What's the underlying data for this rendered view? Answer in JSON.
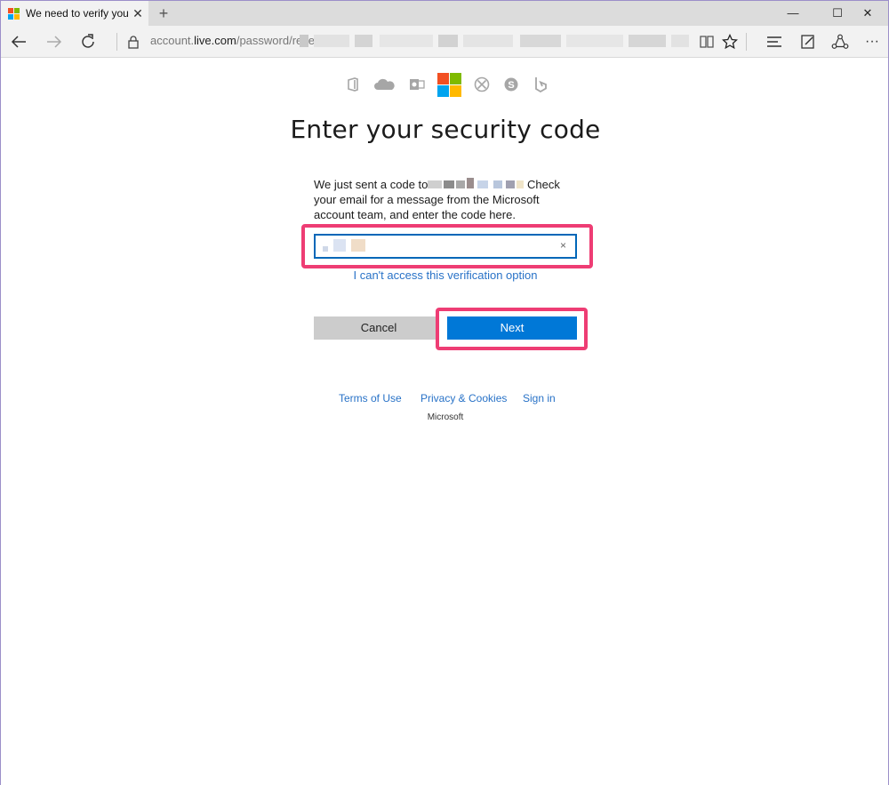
{
  "browser": {
    "tab_title": "We need to verify your i",
    "new_tab_symbol": "+",
    "tab_close_symbol": "✕",
    "url_prefix": "account.",
    "url_domain": "live.com",
    "url_path": "/password/reset",
    "window_controls": {
      "minimize": "—",
      "maximize": "☐",
      "close": "✕"
    },
    "more_symbol": "···"
  },
  "page": {
    "heading": "Enter your security code",
    "description_part1": "We just sent a code to",
    "description_part2": " Check your email for a message from the Microsoft account team, and enter the code here.",
    "clear_symbol": "×",
    "cant_access_link": "I can't access this verification option",
    "cancel_label": "Cancel",
    "next_label": "Next",
    "footer": {
      "terms": "Terms of Use",
      "privacy": "Privacy & Cookies",
      "signin": "Sign in",
      "brand": "Microsoft"
    }
  },
  "colors": {
    "highlight": "#ee3d74",
    "primary_button": "#0078d7",
    "link": "#2872c7",
    "ms_red": "#f25022",
    "ms_green": "#7fba00",
    "ms_blue": "#00a4ef",
    "ms_yellow": "#ffb900"
  },
  "icons": [
    "office-icon",
    "onedrive-icon",
    "outlook-icon",
    "microsoft-logo",
    "xbox-icon",
    "skype-icon",
    "bing-icon"
  ]
}
